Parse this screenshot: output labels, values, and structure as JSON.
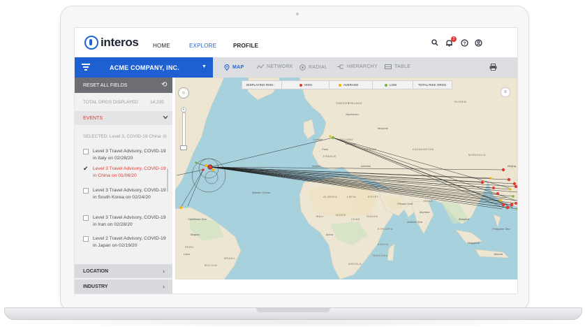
{
  "app": {
    "logo_text": "interos"
  },
  "nav": {
    "home": "HOME",
    "explore": "EXPLORE",
    "profile": "PROFILE",
    "notification_count": "2"
  },
  "toolbar": {
    "company_name": "ACME COMPANY, INC.",
    "tabs": [
      {
        "label": "MAP",
        "icon": "map-pin-icon",
        "active": true
      },
      {
        "label": "NETWORK",
        "icon": "network-icon",
        "active": false
      },
      {
        "label": "RADIAL",
        "icon": "radial-icon",
        "active": false
      },
      {
        "label": "HIERARCHY",
        "icon": "hierarchy-icon",
        "active": false
      },
      {
        "label": "TABLE",
        "icon": "table-icon",
        "active": false
      }
    ]
  },
  "sidebar": {
    "reset_label": "RESET ALL FIELDS",
    "total_label": "TOTAL ORGS DISPLAYED",
    "total_value": "14,235",
    "events_label": "EVENTS",
    "selected_text": "SELECTED: Level 3, COVID-19 China",
    "events": [
      {
        "text": "Level 3 Travel Advisory, COVID-19 in Italy on 02/28/20",
        "checked": false
      },
      {
        "text": "Level 3 Travel Advisory, COVID-19 in China on 01/06/20",
        "checked": true
      },
      {
        "text": "Level 3 Travel Advisory, COVID-19 in South Korea on 02/24/20",
        "checked": false
      },
      {
        "text": "Level 3 Travel Advisory, COVID-19 in Iran on 02/28/20",
        "checked": false
      },
      {
        "text": "Level 2 Travel Advisory, COVID-19 in Japan on 02/19/20",
        "checked": false
      }
    ],
    "sections": [
      {
        "label": "LOCATION"
      },
      {
        "label": "INDUSTRY"
      }
    ]
  },
  "map": {
    "legend": {
      "displaying_risk": "DISPLAYING RISK:",
      "high": "HIGH",
      "average": "AVERAGE",
      "low": "LOW",
      "total_risk_orgs": "TOTAL RISK ORGS"
    },
    "colors": {
      "high": "#e53935",
      "average": "#f4b400",
      "low": "#7cb342",
      "ocean": "#a8d1de",
      "land": "#e9e3cf"
    },
    "places": {
      "russia": "RUSSIA",
      "finland": "FINLAND",
      "sweden": "SWEDEN",
      "stockholm": "Stockholm",
      "moscow": "Moscow",
      "london": "London",
      "poland": "POLAND",
      "warsaw": "Warsaw",
      "paris": "Paris",
      "france": "FRANCE",
      "ukraine": "UKRAINE",
      "kazakhstan": "KAZAKHSTAN",
      "mongolia": "MONGOLIA",
      "beijing": "Beijing",
      "madrid": "Madrid",
      "istanbul": "Istanbul",
      "iran": "IRAN",
      "algeria": "ALGERIA",
      "libya": "LIBYA",
      "egypt": "EGYPT",
      "india": "INDIA",
      "mumbai": "Mumbai",
      "mali": "MALI",
      "niger": "NIGER",
      "chad": "CHAD",
      "sudan": "SUDAN",
      "ethiopia": "ETHIOPIA",
      "accra": "Accra",
      "kenya": "KENYA",
      "tanzania": "TANZANIA",
      "bangkok": "Bangkok",
      "singapore": "Singapore",
      "jakarta": "Jakarta",
      "atlantic": "Atlantic Ocean",
      "caribbean": "Caribbean Sea",
      "brazil": "BRAZIL",
      "bogota": "Bogota",
      "lima": "Lima",
      "peru": "PERU",
      "bolivia": "BOLIVIA",
      "angola": "ANGOLA",
      "persian_gulf": "Persian Gulf",
      "arabian_sea": "Arabian Sea",
      "philippine_sea": "Philippine Sea"
    }
  }
}
